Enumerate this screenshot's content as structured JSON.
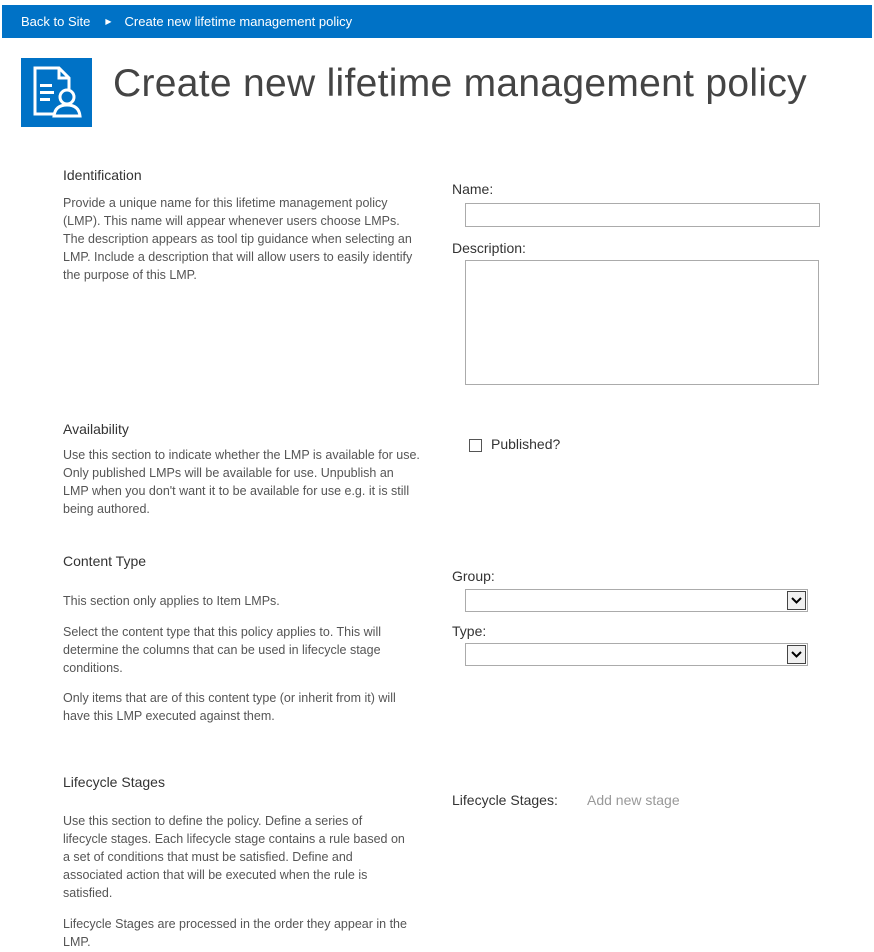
{
  "breadcrumb": {
    "back_label": "Back to Site",
    "current_label": "Create new lifetime management policy"
  },
  "page": {
    "title": "Create new lifetime management policy",
    "icon": "policy-document-icon"
  },
  "colors": {
    "topbar": "#0072c6",
    "icon_bg": "#0072c6"
  },
  "sections": {
    "identification": {
      "title": "Identification",
      "description": "Provide a unique name for this lifetime management policy (LMP). This name will appear whenever users choose LMPs. The description appears as tool tip guidance when selecting an LMP. Include a description that will allow users to easily identify the purpose of this LMP.",
      "name_label": "Name:",
      "name_value": "",
      "description_label": "Description:",
      "description_value": ""
    },
    "availability": {
      "title": "Availability",
      "description": "Use this section to indicate whether the LMP is available for use. Only published LMPs will be available for use. Unpublish an LMP when you don't want it to be available for use e.g. it is still being authored.",
      "published_label": "Published?",
      "published_checked": false
    },
    "content_type": {
      "title": "Content Type",
      "note": "This section only applies to Item LMPs.",
      "description": "Select the content type that this policy applies to. This will determine the columns that can be used in lifecycle stage conditions.",
      "description2": "Only items that are of this content type (or inherit from it) will have this LMP executed against them.",
      "group_label": "Group:",
      "group_value": "",
      "type_label": "Type:",
      "type_value": ""
    },
    "lifecycle": {
      "title": "Lifecycle Stages",
      "description": "Use this section to define the policy. Define a series of lifecycle stages. Each lifecycle stage contains a rule based on a set of conditions that must be satisfied. Define and associated action that will be executed when the rule is satisfied.",
      "description2": "Lifecycle Stages are processed in the order they appear in the LMP.",
      "stages_label": "Lifecycle Stages:",
      "add_stage_label": "Add new stage"
    }
  }
}
